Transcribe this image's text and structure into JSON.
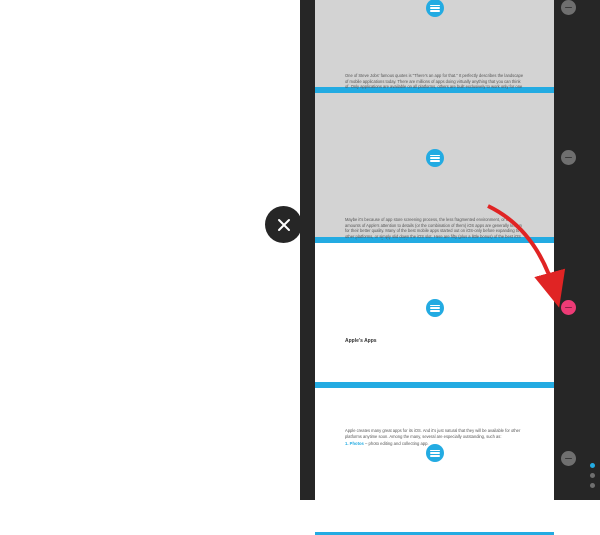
{
  "colors": {
    "accent": "#23abe2",
    "highlight": "#ed3b76",
    "dark": "#262626",
    "grey": "#d3d3d3"
  },
  "sections": {
    "s1": {
      "para": "One of Steve Jobs' famous quotes is \"There's an app for that.\" It perfectly describes the landscape of mobile applications today. There are millions of apps doing virtually anything that you can think of. Only applications are available on all platforms, others are built exclusively to work only for one operating system."
    },
    "s2": {
      "para": "Maybe it's because of app store screening process, the less fragmented environment, or the amounts of Apple's attention to details (or the combination of them) iOS apps are generally known for their better quality. Many of the best mobile apps started out on iOS-only before expanding to other platforms, or simply slid down the iOS slot. Here are fifty (plus a little bonus) of the best iOS apps that you won't find in Android."
    },
    "s3": {
      "heading": "Apple's Apps"
    },
    "s4": {
      "para": "Apple creates many great apps for its iOS. And it's just natural that they will be available for other platforms anytime soon. Among the many, several are especially outstanding, such as:",
      "item_num": "1.",
      "item_title": "Photos",
      "item_rest": " – photo editing and collecting app."
    }
  }
}
